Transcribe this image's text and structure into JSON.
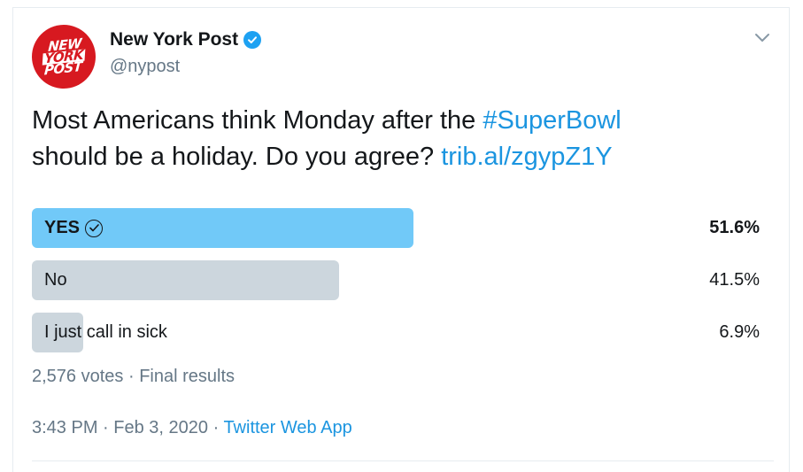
{
  "author": {
    "avatar_lines": [
      "NEW",
      "YORK",
      "POST"
    ],
    "display_name": "New York Post",
    "handle": "@nypost",
    "verified": true
  },
  "tweet": {
    "text_before": "Most Americans think Monday after the ",
    "hashtag": "#SuperBowl",
    "text_middle": " should be a holiday. Do you agree? ",
    "link": "trib.al/zgypZ1Y"
  },
  "poll": {
    "choices": [
      {
        "label": "YES",
        "percent": "51.6%",
        "value": 51.6,
        "winner": true
      },
      {
        "label": "No",
        "percent": "41.5%",
        "value": 41.5,
        "winner": false
      },
      {
        "label": "I just call in sick",
        "percent": "6.9%",
        "value": 6.9,
        "winner": false
      }
    ],
    "votes": "2,576 votes",
    "separator": " · ",
    "status": "Final results"
  },
  "footer": {
    "time": "3:43 PM",
    "separator": " · ",
    "date": "Feb 3, 2020",
    "app": "Twitter Web App"
  },
  "colors": {
    "winner_bar": "#71c9f8",
    "other_bar": "#ccd6dd",
    "link": "#1b95e0",
    "muted": "#657786",
    "verified": "#1da1f2",
    "brand_red": "#d71920"
  }
}
